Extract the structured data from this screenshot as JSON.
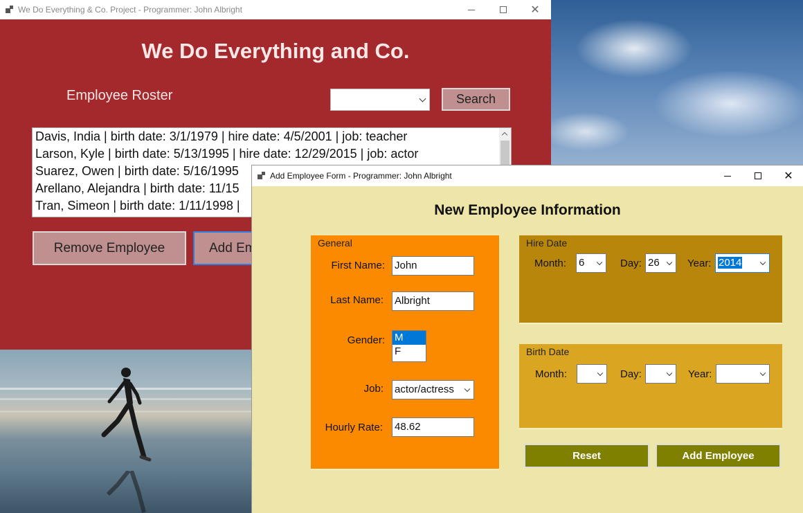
{
  "main_window": {
    "title": "We Do Everything & Co. Project - Programmer: John Albright",
    "heading": "We Do Everything and Co.",
    "roster_label": "Employee Roster",
    "search_combo_value": "",
    "search_label": "Search",
    "roster": [
      "Davis, India | birth date: 3/1/1979 | hire date: 4/5/2001 | job: teacher",
      "Larson, Kyle | birth date: 5/13/1995 | hire date: 12/29/2015 | job: actor",
      "Suarez, Owen | birth date: 5/16/1995",
      "Arellano, Alejandra | birth date: 11/15",
      "Tran, Simeon | birth date: 1/11/1998 |"
    ],
    "remove_label": "Remove Employee",
    "add_label": "Add Em",
    "colors": {
      "background": "#a4292d",
      "button": "#c09090"
    }
  },
  "dialog": {
    "title": "Add Employee Form - Programmer: John Albright",
    "heading": "New Employee Information",
    "general": {
      "legend": "General",
      "first_name_label": "First Name:",
      "first_name": "John",
      "last_name_label": "Last Name:",
      "last_name": "Albright",
      "gender_label": "Gender:",
      "gender_options": [
        "M",
        "F"
      ],
      "gender_selected": "M",
      "job_label": "Job:",
      "job": "actor/actress",
      "rate_label": "Hourly Rate:",
      "rate": "48.62"
    },
    "hire_date": {
      "legend": "Hire Date",
      "month_label": "Month:",
      "month": "6",
      "day_label": "Day:",
      "day": "26",
      "year_label": "Year:",
      "year": "2014"
    },
    "birth_date": {
      "legend": "Birth Date",
      "month_label": "Month:",
      "month": "",
      "day_label": "Day:",
      "day": "",
      "year_label": "Year:",
      "year": ""
    },
    "reset_label": "Reset",
    "add_label": "Add Employee",
    "colors": {
      "background": "#ede6a8",
      "general": "#fb8a00",
      "hire": "#b8860b",
      "birth": "#daa520",
      "button": "#808000"
    }
  }
}
